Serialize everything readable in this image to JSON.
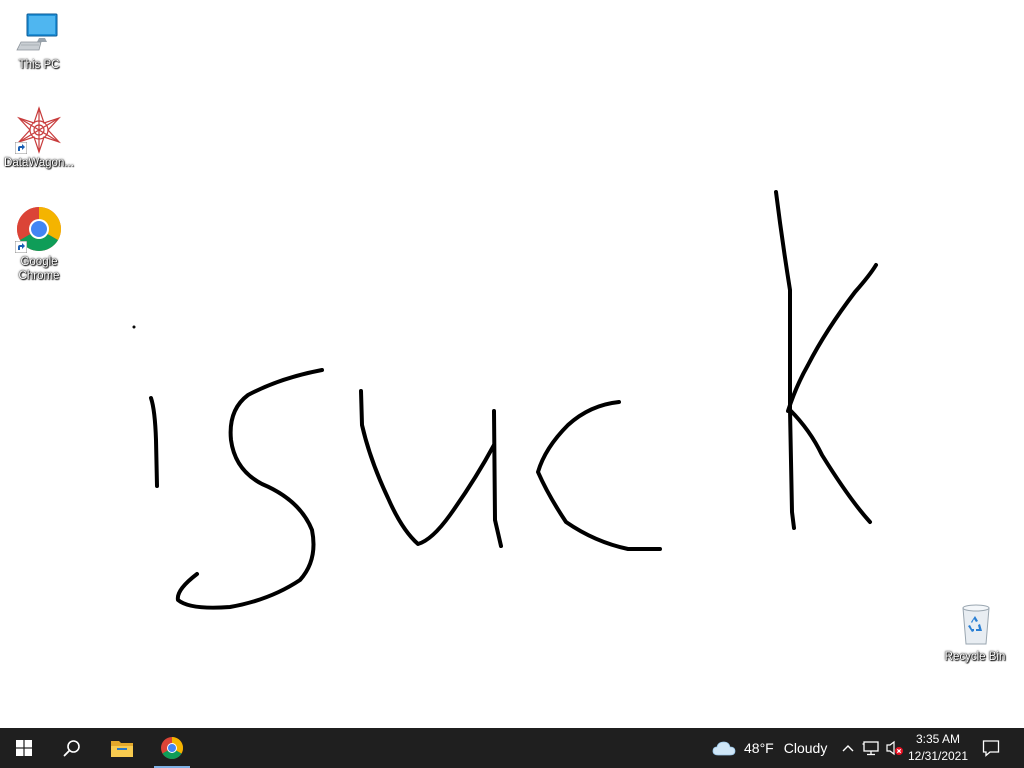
{
  "desktop": {
    "icons": [
      {
        "label": "This PC",
        "icon": "this-pc-icon"
      },
      {
        "label": "DataWagon...",
        "icon": "datawagon-icon"
      },
      {
        "label": "Google Chrome",
        "icon": "chrome-icon"
      },
      {
        "label": "Recycle Bin",
        "icon": "recycle-bin-icon"
      }
    ],
    "drawing": {
      "text": "isuck",
      "stroke_color": "#000000"
    }
  },
  "taskbar": {
    "background": "#1f1f1f",
    "pinned": [
      "start-icon",
      "search-icon",
      "file-explorer-icon",
      "chrome-icon"
    ],
    "weather": {
      "temp": "48°F",
      "condition": "Cloudy"
    },
    "clock": {
      "time": "3:35 AM",
      "date": "12/31/2021"
    },
    "tray": [
      "show-hidden-icons",
      "network-icon",
      "volume-muted-icon",
      "notifications-icon"
    ]
  }
}
